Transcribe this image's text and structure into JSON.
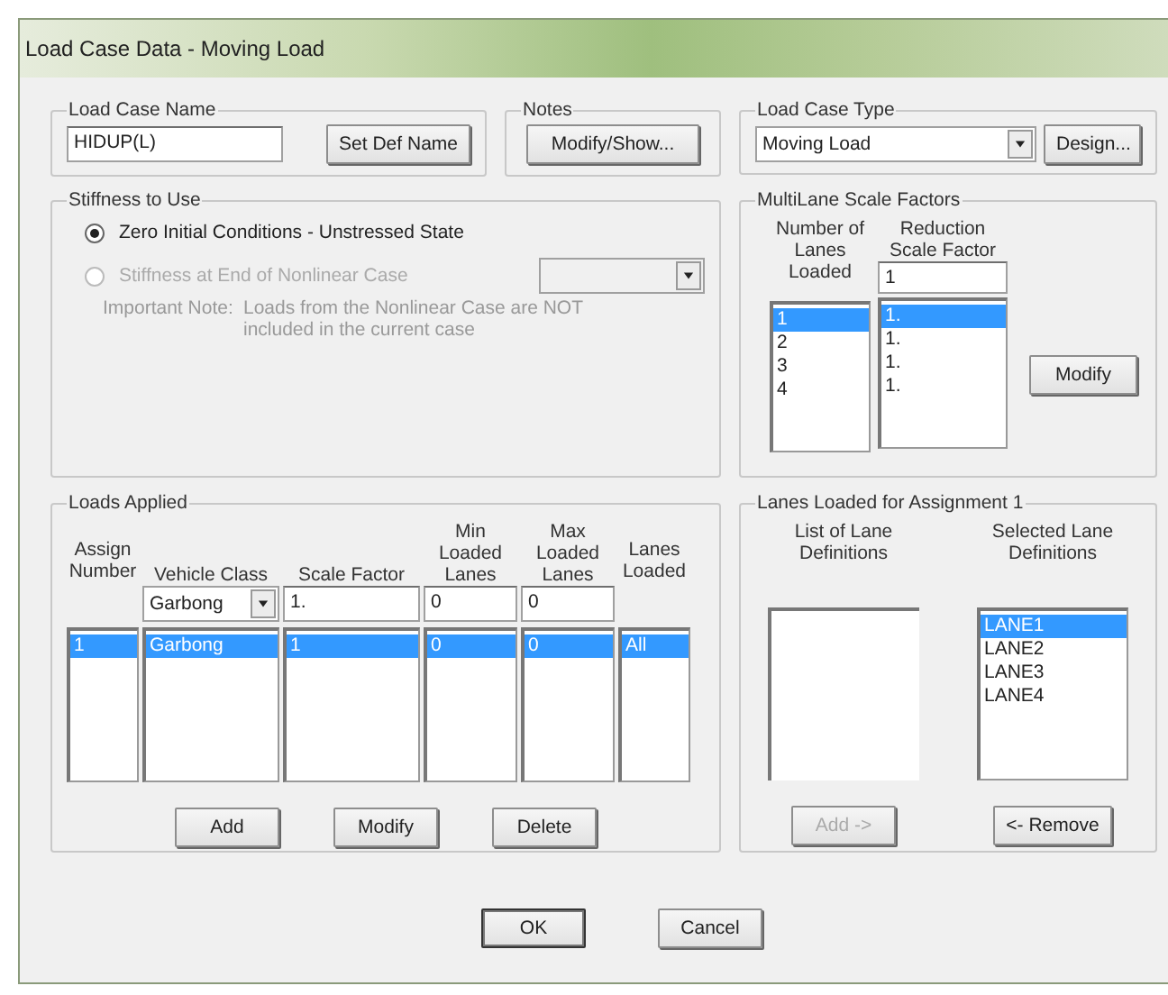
{
  "window": {
    "title": "Load Case Data - Moving Load"
  },
  "load_case_name": {
    "label": "Load Case Name",
    "value": "HIDUP(L)",
    "button": "Set Def Name"
  },
  "notes": {
    "label": "Notes",
    "button": "Modify/Show..."
  },
  "load_case_type": {
    "label": "Load Case Type",
    "value": "Moving Load",
    "button": "Design..."
  },
  "stiffness": {
    "label": "Stiffness to Use",
    "options": [
      {
        "label": "Zero Initial Conditions - Unstressed State",
        "selected": true,
        "disabled": false
      },
      {
        "label": "Stiffness at End of Nonlinear Case",
        "selected": false,
        "disabled": true
      }
    ],
    "note_label": "Important Note:",
    "note_text": "Loads from the Nonlinear Case are NOT included in the current case"
  },
  "multilane": {
    "label": "MultiLane Scale Factors",
    "columns": [
      "Number of Lanes Loaded",
      "Reduction Scale Factor"
    ],
    "input_value": "1",
    "rows": [
      {
        "lanes": "1",
        "factor": "1.",
        "selected": true
      },
      {
        "lanes": "2",
        "factor": "1.",
        "selected": false
      },
      {
        "lanes": "3",
        "factor": "1.",
        "selected": false
      },
      {
        "lanes": "4",
        "factor": "1.",
        "selected": false
      }
    ],
    "button": "Modify"
  },
  "loads_applied": {
    "label": "Loads Applied",
    "columns": [
      "Assign Number",
      "Vehicle Class",
      "Scale Factor",
      "Min Loaded Lanes",
      "Max Loaded Lanes",
      "Lanes Loaded"
    ],
    "edit_row": {
      "vehicle_class": "Garbong",
      "scale_factor": "1.",
      "min_loaded_lanes": "0",
      "max_loaded_lanes": "0"
    },
    "rows": [
      {
        "cells": [
          "1",
          "Garbong",
          "1",
          "0",
          "0",
          "All"
        ],
        "selected": true
      }
    ],
    "buttons": [
      "Add",
      "Modify",
      "Delete"
    ]
  },
  "lanes_loaded": {
    "label": "Lanes Loaded for Assignment 1",
    "list_heading": "List of Lane Definitions",
    "selected_heading": "Selected Lane Definitions",
    "selected_lanes": [
      {
        "label": "LANE1",
        "selected": true
      },
      {
        "label": "LANE2",
        "selected": false
      },
      {
        "label": "LANE3",
        "selected": false
      },
      {
        "label": "LANE4",
        "selected": false
      }
    ],
    "add_button": {
      "label": "Add ->",
      "disabled": true
    },
    "remove_button": {
      "label": "<- Remove",
      "disabled": false
    }
  },
  "buttons": [
    {
      "label": "OK",
      "default": true
    },
    {
      "label": "Cancel",
      "default": false
    }
  ]
}
